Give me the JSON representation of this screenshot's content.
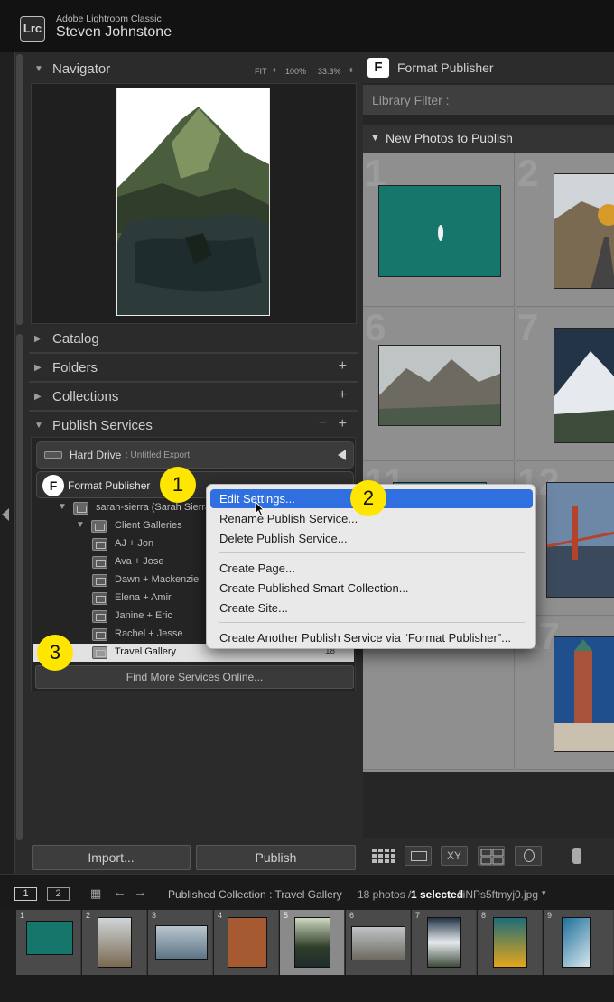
{
  "app": {
    "product": "Adobe Lightroom Classic",
    "logo": "Lrc",
    "user": "Steven Johnstone"
  },
  "navigator": {
    "title": "Navigator",
    "zoom": [
      "FIT",
      "100%",
      "33.3%"
    ]
  },
  "panels": {
    "catalog": "Catalog",
    "folders": "Folders",
    "collections": "Collections",
    "publish": "Publish Services"
  },
  "publish": {
    "hard_drive": {
      "name": "Hard Drive",
      "sub": ": Untitled Export"
    },
    "format": {
      "name": "Format Publisher",
      "logo": "F"
    },
    "account": "sarah-sierra (Sarah Sierra",
    "folder": "Client Galleries",
    "items": [
      "AJ + Jon",
      "Ava + Jose",
      "Dawn + Mackenzie",
      "Elena + Amir",
      "Janine + Eric",
      "Rachel + Jesse"
    ],
    "selected": {
      "name": "Travel Gallery",
      "count": "18"
    },
    "find_more": "Find More Services Online..."
  },
  "bottom_buttons": {
    "import": "Import...",
    "publish": "Publish"
  },
  "right": {
    "header": "Format Publisher",
    "logo": "F",
    "library_filter": "Library Filter :",
    "section": "New Photos to Publish",
    "cell_numbers": [
      "1",
      "2",
      "6",
      "7",
      "11",
      "12",
      "16",
      "17"
    ]
  },
  "context_menu": {
    "items": [
      "Edit Settings...",
      "Rename Publish Service...",
      "Delete Publish Service...",
      "Create Page...",
      "Create Published Smart Collection...",
      "Create Site...",
      "Create Another Publish Service via “Format Publisher”..."
    ],
    "highlight_color": "#2f6fe0"
  },
  "callouts": [
    "1",
    "2",
    "3"
  ],
  "filmstrip": {
    "monitors": [
      "1",
      "2"
    ],
    "path": "Published Collection : Travel Gallery",
    "count": "18 photos /",
    "selected": "1 selected",
    "file": "/ iNPs5ftmyj0.jpg",
    "numbers": [
      "1",
      "2",
      "3",
      "4",
      "5",
      "6",
      "7",
      "8",
      "9"
    ]
  },
  "colors": {
    "accent": "#ffe600",
    "panel": "#2b2b2b",
    "grid": "#8f8f8f"
  }
}
